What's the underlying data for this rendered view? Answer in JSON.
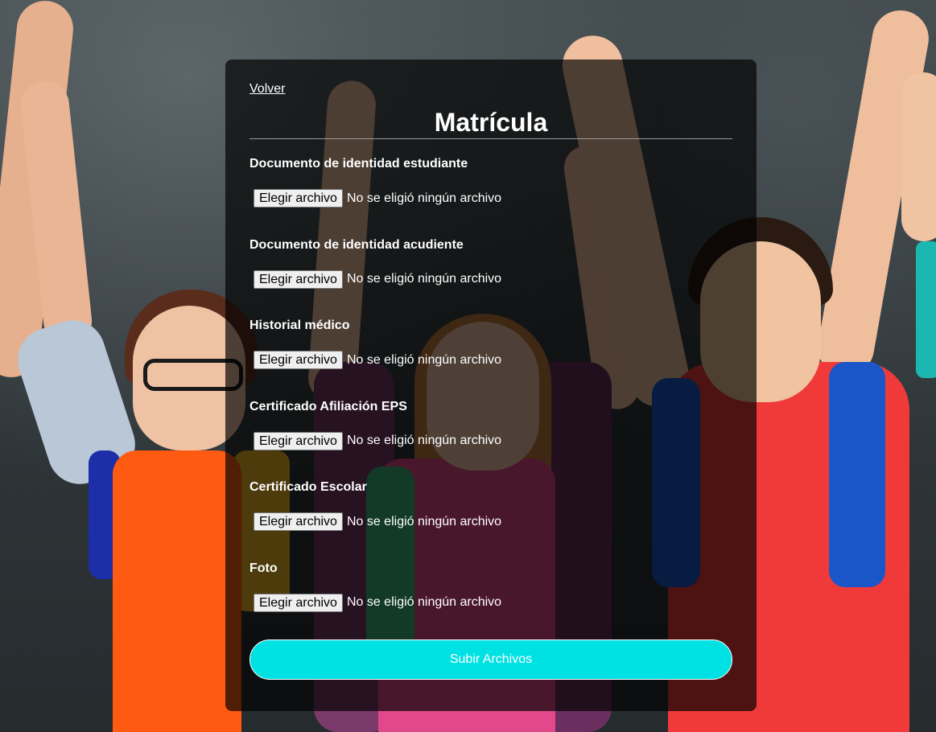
{
  "page": {
    "back_link": "Volver",
    "title": "Matrícula"
  },
  "fields": [
    {
      "label": "Documento de identidad estudiante",
      "button_label": "Elegir archivo",
      "status": "No se eligió ningún archivo"
    },
    {
      "label": "Documento de identidad acudiente",
      "button_label": "Elegir archivo",
      "status": "No se eligió ningún archivo"
    },
    {
      "label": "Historial médico",
      "button_label": "Elegir archivo",
      "status": "No se eligió ningún archivo"
    },
    {
      "label": "Certificado Afiliación EPS",
      "button_label": "Elegir archivo",
      "status": "No se eligió ningún archivo"
    },
    {
      "label": "Certificado Escolar",
      "button_label": "Elegir archivo",
      "status": "No se eligió ningún archivo"
    },
    {
      "label": "Foto",
      "button_label": "Elegir archivo",
      "status": "No se eligió ningún archivo"
    }
  ],
  "submit": {
    "label": "Subir Archivos"
  },
  "colors": {
    "panel_bg": "rgba(0,0,0,0.68)",
    "submit_bg": "#00e1e4",
    "text": "#ffffff"
  }
}
